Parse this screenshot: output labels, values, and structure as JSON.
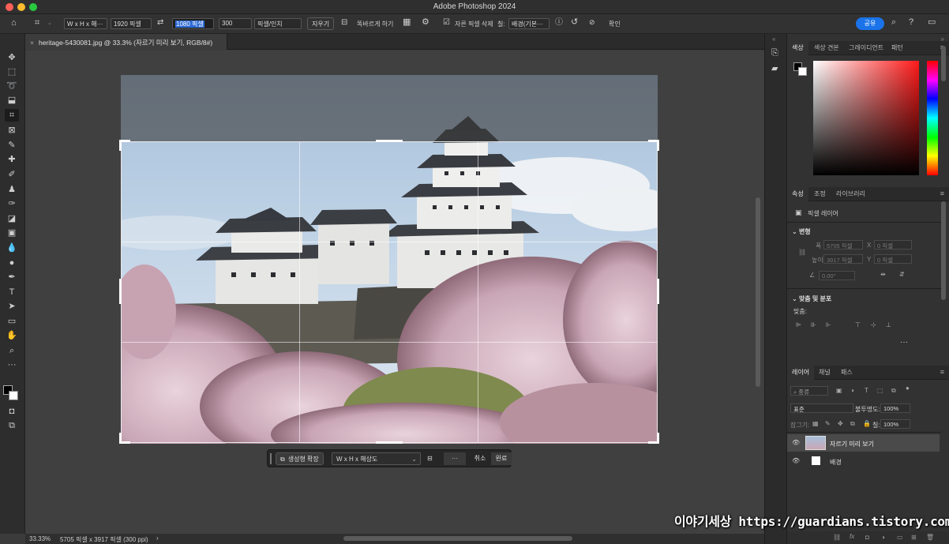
{
  "window": {
    "title": "Adobe Photoshop 2024"
  },
  "options_bar": {
    "ratio_preset": "W x H x 해···",
    "width_value": "1920 픽셀",
    "height_value": "1080 픽셀",
    "resolution_value": "300",
    "resolution_unit": "픽셀/인치",
    "clear_label": "지우기",
    "straighten_label": "똑바르게 하기",
    "delete_cropped_label": "자른 픽셀 삭제",
    "fill_label": "칠:",
    "fill_value": "배경(기본···",
    "confirm_label": "확인",
    "share_label": "공유",
    "icons": [
      "home-icon",
      "crop-tool-icon",
      "swap-icon",
      "overlay-grid-icon",
      "gear-icon",
      "info-icon",
      "undo-icon",
      "cancel-icon",
      "search-icon",
      "help-icon",
      "workspace-icon"
    ]
  },
  "document_tab": {
    "label": "heritage-5430081.jpg @ 33.3% (자르기 미리 보기, RGB/8#)"
  },
  "tools": [
    "move",
    "marquee",
    "lasso",
    "object-select",
    "crop",
    "frame",
    "eyedropper",
    "healing",
    "brush",
    "stamp",
    "history-brush",
    "eraser",
    "gradient",
    "blur",
    "dodge",
    "pen",
    "type",
    "path-select",
    "rectangle",
    "hand",
    "zoom",
    "more"
  ],
  "contextual_bar": {
    "generative_expand": "생성형 확장",
    "ratio_select": "W x H x 해상도",
    "more": "···",
    "cancel": "취소",
    "done": "완료"
  },
  "status_bar": {
    "zoom": "33.33%",
    "doc_info": "5705 픽셀 x 3917 픽셀 (300 ppi)",
    "arrow": "›"
  },
  "color_panel": {
    "tabs": [
      "색상",
      "색상 견본",
      "그레이디언트",
      "패턴"
    ],
    "foreground": "#000000",
    "background": "#ffffff",
    "hue": "#ff1a1a"
  },
  "properties_panel": {
    "tabs": [
      "속성",
      "조정",
      "라이브러리"
    ],
    "layer_type": "픽셀 레이어",
    "transform_heading": "변형",
    "w_label": "폭",
    "w_value": "5705 픽셀",
    "h_label": "높이",
    "h_value": "3917 픽셀",
    "x_label": "X",
    "x_value": "0 픽셀",
    "y_label": "Y",
    "y_value": "0 픽셀",
    "angle_value": "0.00°",
    "align_heading": "맞춤 및 분포",
    "align_label": "맞춤:",
    "more": "···"
  },
  "layers_panel": {
    "tabs": [
      "레이어",
      "채널",
      "패스"
    ],
    "filter_label": "종류",
    "blend_mode": "표준",
    "opacity_label": "불투명도:",
    "opacity_value": "100%",
    "lock_label": "잠그기:",
    "fill_label": "칠:",
    "fill_value": "100%",
    "layers": [
      {
        "name": "자르기 미리 보기",
        "selected": true
      },
      {
        "name": "배경",
        "selected": false
      }
    ]
  },
  "watermark": "이야기세상 https://guardians.tistory.com"
}
